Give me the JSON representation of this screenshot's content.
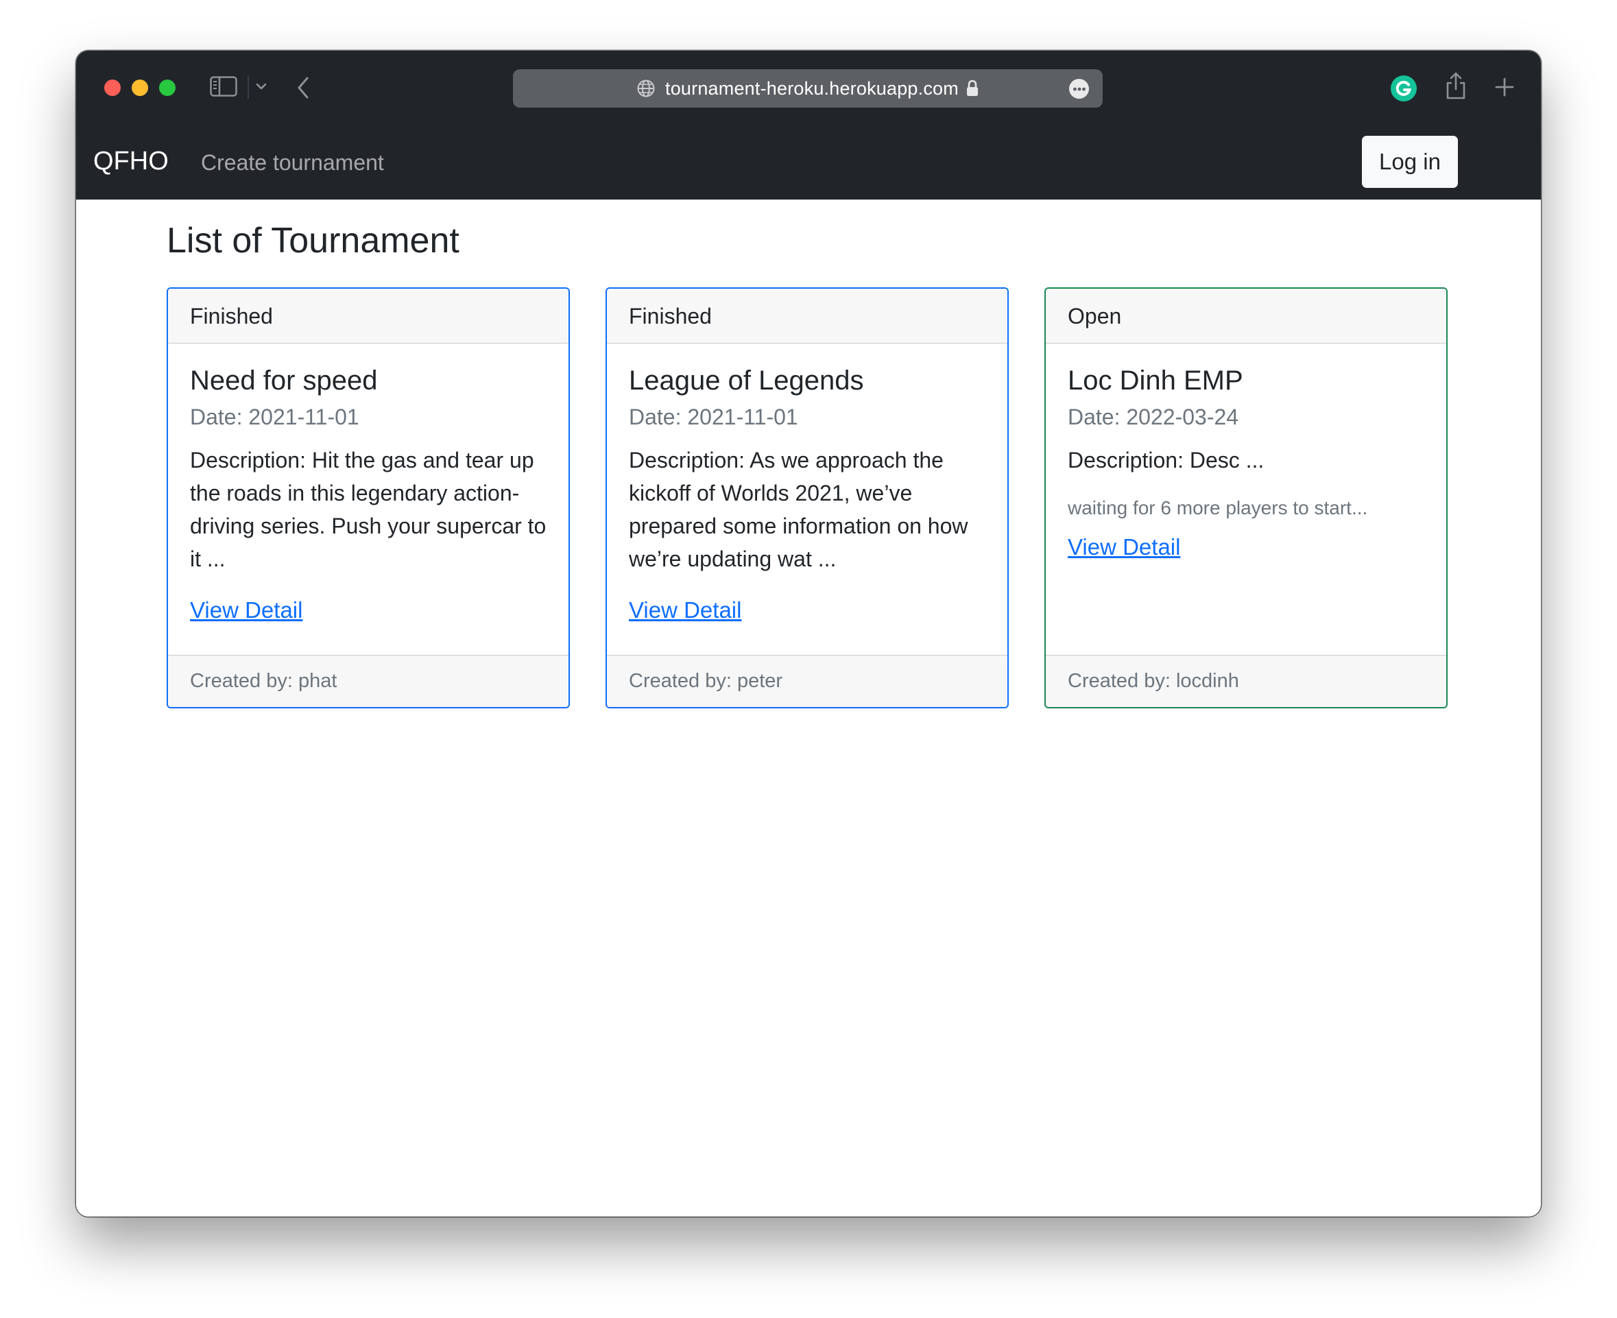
{
  "browser": {
    "url": "tournament-heroku.herokuapp.com",
    "icons": [
      "sidebar-icon",
      "chevron-down-icon",
      "back-icon",
      "globe-icon",
      "lock-icon",
      "more-icon",
      "grammarly-icon",
      "share-icon",
      "plus-icon"
    ],
    "colors": {
      "chrome": "#212529",
      "urlbar": "#5c5f63",
      "grammarly": "#15c39a"
    }
  },
  "navbar": {
    "brand": "QFHO",
    "create_link": "Create tournament",
    "login_label": "Log in"
  },
  "page": {
    "title": "List of Tournament"
  },
  "cards": [
    {
      "status": "Finished",
      "title": "Need for speed",
      "date": "Date: 2021-11-01",
      "description": "Description: Hit the gas and tear up the roads in this legendary action-driving series. Push your supercar to it ...",
      "link": "View Detail",
      "creator": "Created by: phat",
      "border_color": "#0d6efd"
    },
    {
      "status": "Finished",
      "title": "League of Legends",
      "date": "Date: 2021-11-01",
      "description": "Description: As we approach the kickoff of Worlds 2021, we’ve prepared some information on how we’re updating wat ...",
      "link": "View Detail",
      "creator": "Created by: peter",
      "border_color": "#0d6efd"
    },
    {
      "status": "Open",
      "title": "Loc Dinh EMP",
      "date": "Date: 2022-03-24",
      "description": "Description: Desc ...",
      "waiting": "waiting for 6 more players to start...",
      "link": "View Detail",
      "creator": "Created by: locdinh",
      "border_color": "#198754"
    }
  ]
}
